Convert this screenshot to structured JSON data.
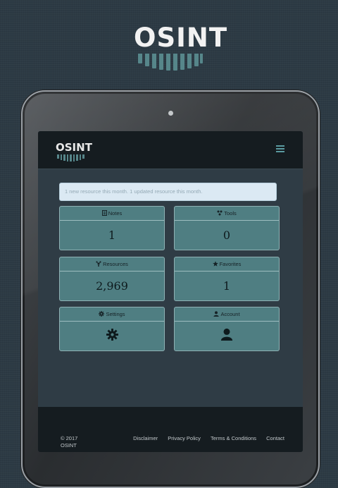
{
  "brand": {
    "logo_text": "OSINT"
  },
  "alert": {
    "text": "1 new resource this month. 1 updated resource this month."
  },
  "cards": [
    {
      "label": "Notes",
      "value": "1",
      "icon": "notebook-icon"
    },
    {
      "label": "Tools",
      "value": "0",
      "icon": "tools-dots-icon"
    },
    {
      "label": "Resources",
      "value": "2,969",
      "icon": "resources-icon"
    },
    {
      "label": "Favorites",
      "value": "1",
      "icon": "star-icon"
    },
    {
      "label": "Settings",
      "value": "",
      "icon": "gear-icon"
    },
    {
      "label": "Account",
      "value": "",
      "icon": "user-icon"
    }
  ],
  "footer": {
    "copyright_year": "© 2017",
    "copyright_name": "OSINT",
    "links": [
      "Disclaimer",
      "Privacy Policy",
      "Terms & Conditions",
      "Contact"
    ]
  },
  "colors": {
    "accent": "#56868a",
    "card_bg": "#4f7e82",
    "navbar_bg": "#151c20"
  }
}
